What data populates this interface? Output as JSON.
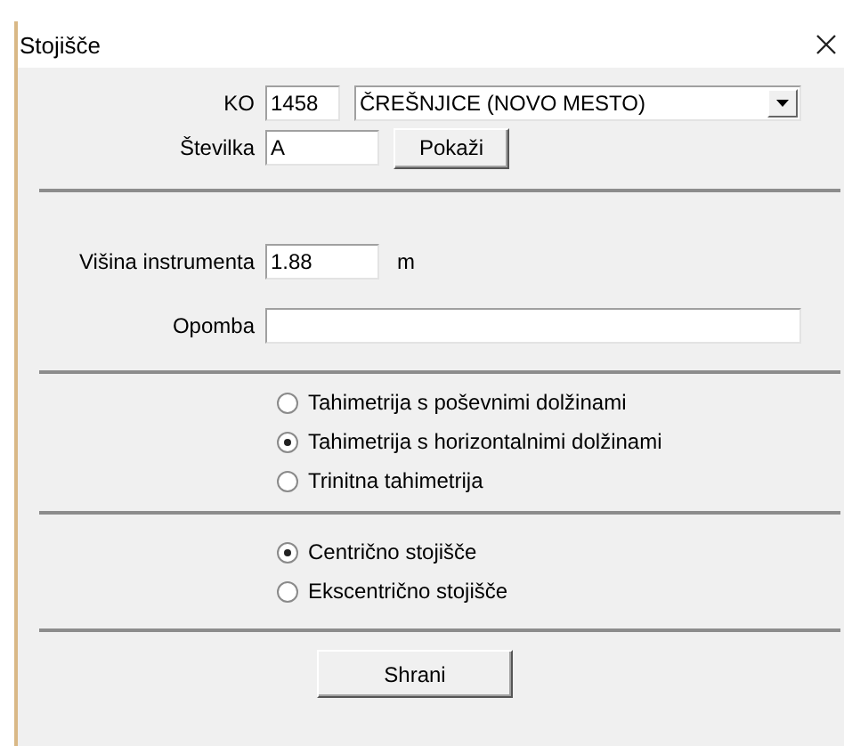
{
  "window": {
    "title": "Stojišče"
  },
  "ko": {
    "label": "KO",
    "code": "1458",
    "name": "ČREŠNJICE (NOVO MESTO)"
  },
  "stevilka": {
    "label": "Številka",
    "value": "A",
    "button": "Pokaži"
  },
  "visina": {
    "label": "Višina instrumenta",
    "value": "1.88",
    "unit": "m"
  },
  "opomba": {
    "label": "Opomba"
  },
  "method_options": [
    {
      "label": "Tahimetrija s poševnimi dolžinami",
      "selected": false
    },
    {
      "label": "Tahimetrija s horizontalnimi dolžinami",
      "selected": true
    },
    {
      "label": "Trinitna tahimetrija",
      "selected": false
    }
  ],
  "station_options": [
    {
      "label": "Centrično stojišče",
      "selected": true
    },
    {
      "label": "Ekscentrično stojišče",
      "selected": false
    }
  ],
  "save_button": "Shrani"
}
